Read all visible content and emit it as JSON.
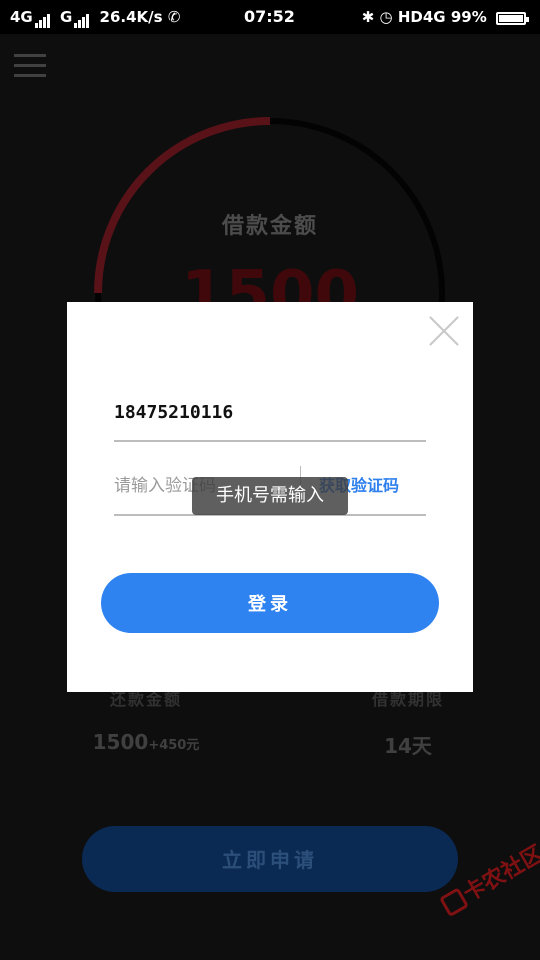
{
  "status_bar": {
    "network1": "4G",
    "network2": "G",
    "speed": "26.4K/s",
    "time": "07:52",
    "hd": "HD",
    "network3": "4G",
    "battery": "99%"
  },
  "main": {
    "gauge_label": "借款金额",
    "gauge_amount": "1500",
    "repay_label": "还款金额",
    "repay_value": "1500",
    "repay_extra": "+450元",
    "term_label": "借款期限",
    "term_value": "14天",
    "apply_button": "立即申请"
  },
  "dialog": {
    "phone_value": "18475210116",
    "code_placeholder": "请输入验证码",
    "get_code_label": "获取验证码",
    "login_button": "登录"
  },
  "toast": {
    "message": "手机号需输入"
  },
  "watermark": {
    "text": "卡农社区"
  },
  "colors": {
    "accent": "#2f83f1",
    "gauge_arc": "#7a1a22"
  }
}
